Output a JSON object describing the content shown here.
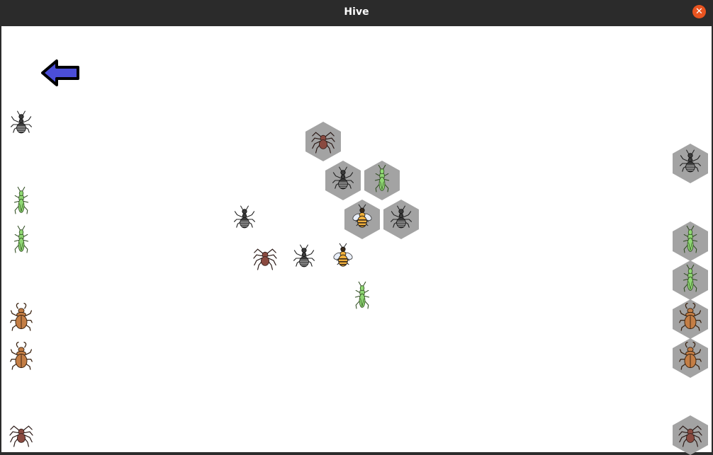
{
  "window": {
    "title": "Hive",
    "close_glyph": "✕",
    "close_icon": "close-icon",
    "colors": {
      "titlebar": "#2b2b2b",
      "close": "#e95420",
      "board": "#ffffff",
      "hex_fill": "#a3a3a3",
      "back_arrow": "#4b4ed8"
    }
  },
  "toolbar": {
    "back_icon": "left-arrow-icon"
  },
  "left_hand": [
    "ant",
    "grasshopper",
    "grasshopper",
    "beetle",
    "beetle",
    "spider"
  ],
  "right_hand": [
    "ant",
    "grasshopper",
    "grasshopper",
    "beetle",
    "beetle",
    "spider"
  ],
  "board_pieces": [
    {
      "bug": "spider",
      "placed": true
    },
    {
      "bug": "ant",
      "placed": true
    },
    {
      "bug": "grasshopper",
      "placed": true
    },
    {
      "bug": "bee",
      "placed": true
    },
    {
      "bug": "ant",
      "placed": true
    },
    {
      "bug": "ant",
      "placed": false
    },
    {
      "bug": "spider",
      "placed": false
    },
    {
      "bug": "ant",
      "placed": false
    },
    {
      "bug": "bee",
      "placed": false
    },
    {
      "bug": "grasshopper",
      "placed": false
    }
  ]
}
